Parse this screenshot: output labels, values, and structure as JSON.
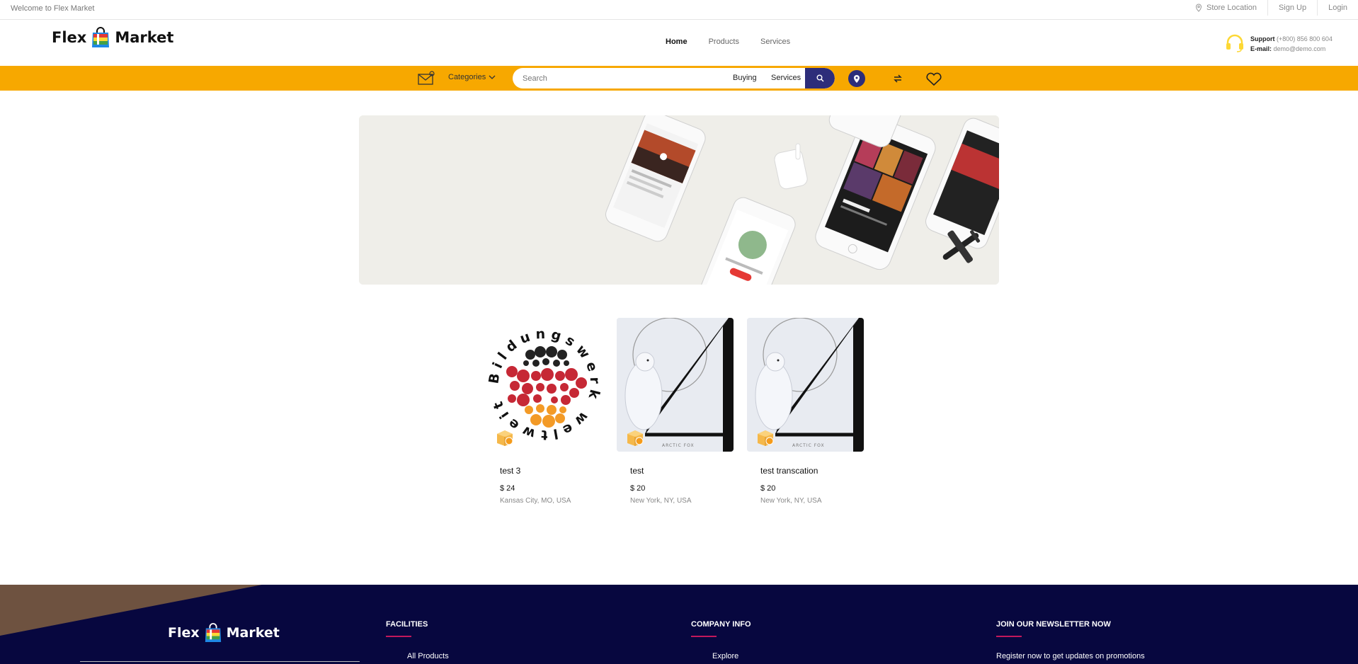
{
  "topbar": {
    "welcome": "Welcome to Flex Market",
    "store_location": "Store Location",
    "sign_up": "Sign Up",
    "login": "Login"
  },
  "brand": {
    "left": "Flex",
    "right": "Market"
  },
  "nav": {
    "home": "Home",
    "products": "Products",
    "services": "Services"
  },
  "support": {
    "label": "Support",
    "phone": "(+800) 856 800 604",
    "email_label": "E-mail:",
    "email": "demo@demo.com"
  },
  "searchbar": {
    "categories": "Categories",
    "placeholder": "Search",
    "opt_buying": "Buying",
    "opt_services": "Services"
  },
  "products": [
    {
      "title": "test 3",
      "price": "$ 24",
      "location": "Kansas City, MO, USA"
    },
    {
      "title": "test",
      "price": "$ 20",
      "location": "New York, NY, USA"
    },
    {
      "title": "test transcation",
      "price": "$ 20",
      "location": "New York, NY, USA"
    }
  ],
  "product_art": {
    "badge_ring_text": "Bildungswerk weltweit",
    "brand_text": "ARCTIC FOX"
  },
  "footer": {
    "facilities": {
      "heading": "FACILITIES",
      "link": "All Products"
    },
    "company": {
      "heading": "COMPANY INFO",
      "link": "Explore"
    },
    "newsletter": {
      "heading": "JOIN OUR NEWSLETTER NOW",
      "text": "Register now to get updates on promotions"
    }
  },
  "colors": {
    "accent": "#f7a800",
    "navy": "#2d2d7a",
    "footer": "#07073f"
  }
}
